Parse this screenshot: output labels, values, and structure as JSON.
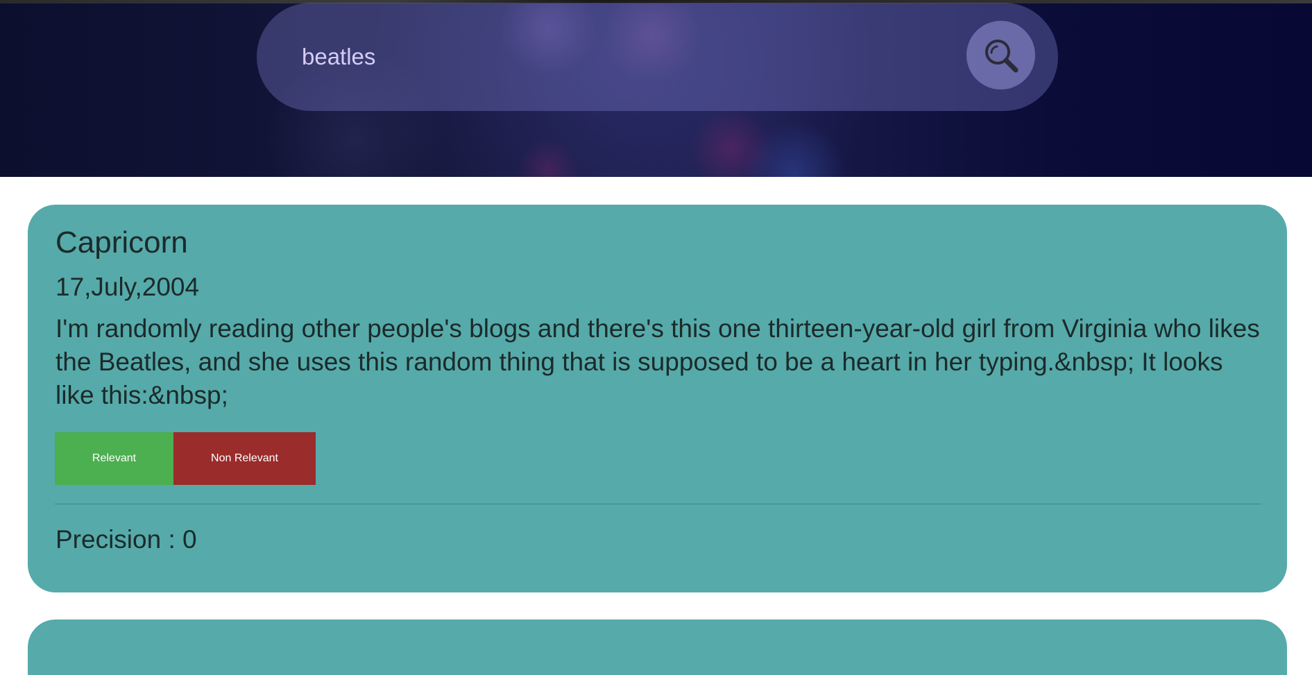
{
  "search": {
    "query": "beatles"
  },
  "results": [
    {
      "title": "Capricorn",
      "date": "17,July,2004",
      "text": "I'm randomly reading other people's blogs and there's this one thirteen-year-old girl from Virginia who likes the Beatles, and she uses this random thing that is supposed to be a heart in her typing.&nbsp; It looks like this:&nbsp;",
      "relevant_label": "Relevant",
      "non_relevant_label": "Non Relevant",
      "precision_label": "Precision",
      "precision_separator": " : ",
      "precision_value": "0"
    }
  ],
  "icons": {
    "search_button": "search-icon"
  },
  "colors": {
    "card_background": "#56aaaa",
    "relevant_button": "#4caf50",
    "non_relevant_button": "#9b2c2c",
    "hero_background": "#16183e"
  }
}
